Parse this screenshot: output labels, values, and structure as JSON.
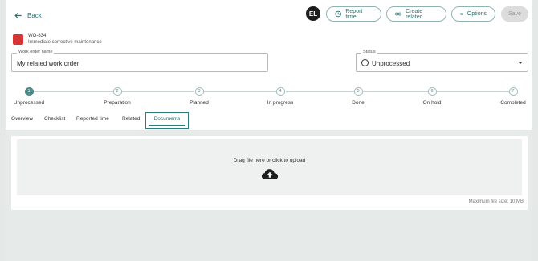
{
  "header": {
    "back_label": "Back",
    "avatar_initials": "EL",
    "report_time_label": "Report time",
    "create_related_label": "Create related",
    "options_label": "Options",
    "save_label": "Save"
  },
  "work_order": {
    "id": "WO-834",
    "type": "Immediate corrective maintenance",
    "color": "#d83434",
    "name_label": "Work order name",
    "name_value": "My related work order",
    "status_label": "Status",
    "status_value": "Unprocessed"
  },
  "stepper": {
    "steps": [
      {
        "number": "1",
        "label": "Unprocessed"
      },
      {
        "number": "2",
        "label": "Preparation"
      },
      {
        "number": "3",
        "label": "Planned"
      },
      {
        "number": "4",
        "label": "In progress"
      },
      {
        "number": "5",
        "label": "Done"
      },
      {
        "number": "6",
        "label": "On hold"
      },
      {
        "number": "7",
        "label": "Completed"
      }
    ],
    "active_index": 0
  },
  "tabs": {
    "overview": "Overview",
    "checklist": "Checklist",
    "reported_time": "Reported time",
    "related": "Related",
    "documents": "Documents"
  },
  "documents": {
    "drop_text": "Drag file here or click to upload",
    "max_size": "Maximum file size: 10 MB"
  },
  "colors": {
    "accent": "#2e7d7d",
    "step_active": "#4a8c8a",
    "wo_color": "#d83434"
  },
  "icons": {
    "back": "arrow-left-icon",
    "report_time": "clock-icon",
    "create_related": "link-icon",
    "options": "sliders-icon",
    "status": "circle-icon",
    "upload": "cloud-upload-icon"
  }
}
